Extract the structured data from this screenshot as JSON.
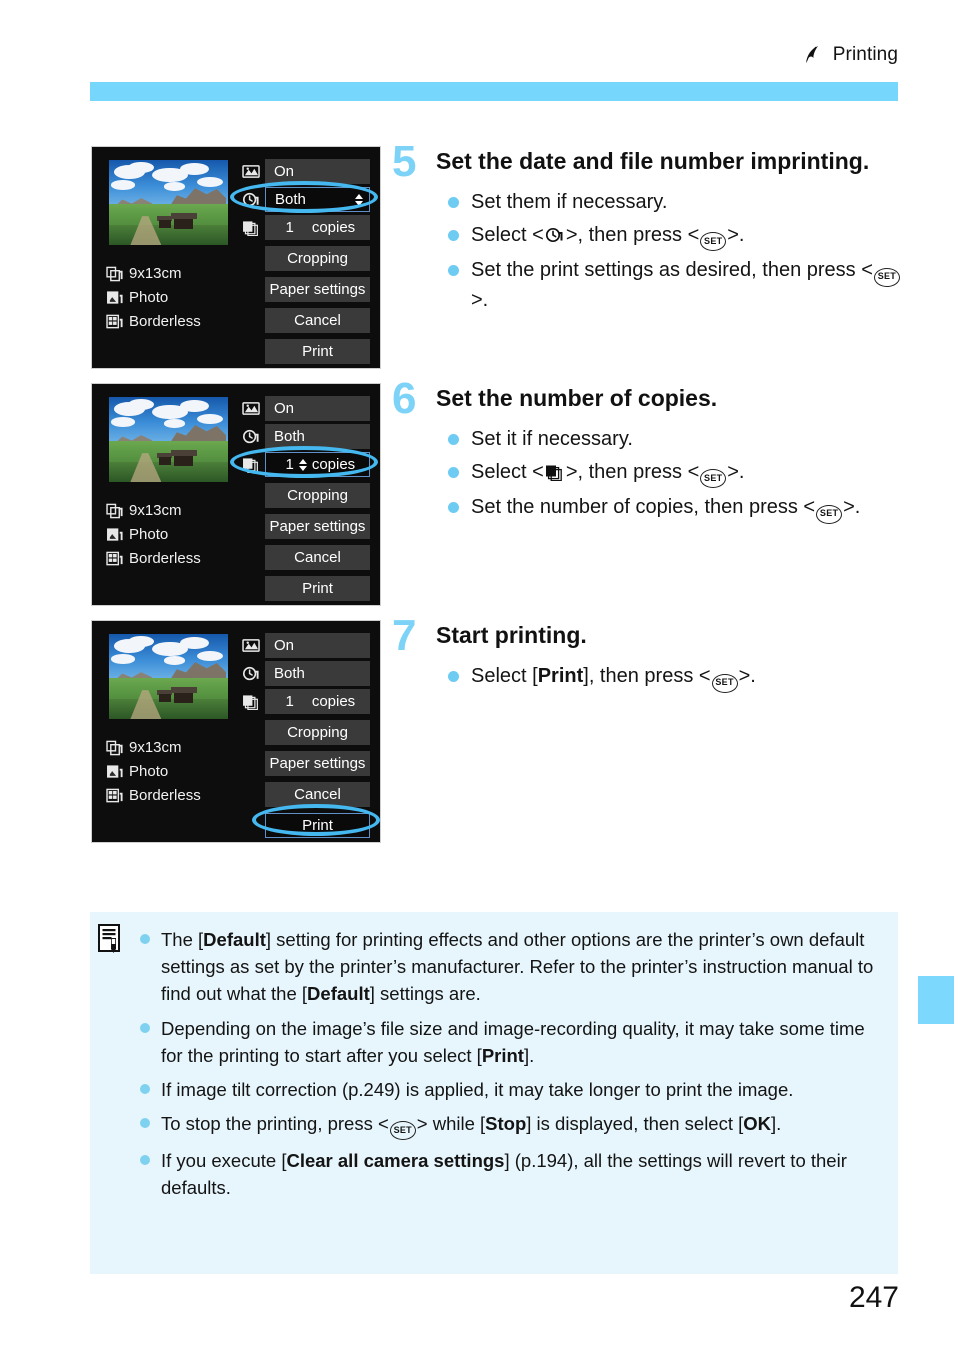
{
  "header": {
    "icon": "printing-chapter-icon",
    "title": "Printing"
  },
  "page_number": "247",
  "lcd_screens": [
    {
      "id": "screen-step5",
      "thumbnail_alt": "landscape-photo-thumbnail",
      "left_labels": [
        {
          "icon": "paper-size-icon",
          "label": "9x13cm"
        },
        {
          "icon": "paper-type-icon",
          "label": "Photo"
        },
        {
          "icon": "page-layout-icon",
          "label": "Borderless"
        }
      ],
      "options": [
        {
          "icon": "printing-effect-icon",
          "label": "On",
          "selected": false,
          "spinner": false
        },
        {
          "icon": "date-imprint-icon",
          "label": "Both",
          "selected": true,
          "spinner": true
        },
        {
          "icon": "copies-icon",
          "value": "1",
          "label": "copies",
          "selected": false,
          "spinner": false
        }
      ],
      "buttons": [
        {
          "label": "Cropping",
          "selected": false
        },
        {
          "label": "Paper settings",
          "selected": false
        },
        {
          "label": "Cancel",
          "selected": false
        },
        {
          "label": "Print",
          "selected": false
        }
      ],
      "highlight": "date-imprint-row"
    },
    {
      "id": "screen-step6",
      "thumbnail_alt": "landscape-photo-thumbnail",
      "left_labels": [
        {
          "icon": "paper-size-icon",
          "label": "9x13cm"
        },
        {
          "icon": "paper-type-icon",
          "label": "Photo"
        },
        {
          "icon": "page-layout-icon",
          "label": "Borderless"
        }
      ],
      "options": [
        {
          "icon": "printing-effect-icon",
          "label": "On",
          "selected": false,
          "spinner": false
        },
        {
          "icon": "date-imprint-icon",
          "label": "Both",
          "selected": false,
          "spinner": false
        },
        {
          "icon": "copies-icon",
          "value": "1",
          "label": "copies",
          "selected": true,
          "spinner": true
        }
      ],
      "buttons": [
        {
          "label": "Cropping",
          "selected": false
        },
        {
          "label": "Paper settings",
          "selected": false
        },
        {
          "label": "Cancel",
          "selected": false
        },
        {
          "label": "Print",
          "selected": false
        }
      ],
      "highlight": "copies-row"
    },
    {
      "id": "screen-step7",
      "thumbnail_alt": "landscape-photo-thumbnail",
      "left_labels": [
        {
          "icon": "paper-size-icon",
          "label": "9x13cm"
        },
        {
          "icon": "paper-type-icon",
          "label": "Photo"
        },
        {
          "icon": "page-layout-icon",
          "label": "Borderless"
        }
      ],
      "options": [
        {
          "icon": "printing-effect-icon",
          "label": "On",
          "selected": false,
          "spinner": false
        },
        {
          "icon": "date-imprint-icon",
          "label": "Both",
          "selected": false,
          "spinner": false
        },
        {
          "icon": "copies-icon",
          "value": "1",
          "label": "copies",
          "selected": false,
          "spinner": false
        }
      ],
      "buttons": [
        {
          "label": "Cropping",
          "selected": false
        },
        {
          "label": "Paper settings",
          "selected": false
        },
        {
          "label": "Cancel",
          "selected": false
        },
        {
          "label": "Print",
          "selected": true
        }
      ],
      "highlight": "print-button"
    }
  ],
  "steps": [
    {
      "number": "5",
      "title": "Set the date and file number imprinting.",
      "bullets": [
        {
          "parts": [
            {
              "t": "text",
              "v": "Set them if necessary."
            }
          ]
        },
        {
          "parts": [
            {
              "t": "text",
              "v": "Select <"
            },
            {
              "t": "icon",
              "v": "date-imprint-icon"
            },
            {
              "t": "text",
              "v": ">, then press <"
            },
            {
              "t": "set",
              "v": "SET"
            },
            {
              "t": "text",
              "v": ">."
            }
          ]
        },
        {
          "parts": [
            {
              "t": "text",
              "v": "Set the print settings as desired, then press <"
            },
            {
              "t": "set",
              "v": "SET"
            },
            {
              "t": "text",
              "v": ">."
            }
          ]
        }
      ]
    },
    {
      "number": "6",
      "title": "Set the number of copies.",
      "bullets": [
        {
          "parts": [
            {
              "t": "text",
              "v": "Set it if necessary."
            }
          ]
        },
        {
          "parts": [
            {
              "t": "text",
              "v": "Select <"
            },
            {
              "t": "icon",
              "v": "copies-icon"
            },
            {
              "t": "text",
              "v": ">, then press <"
            },
            {
              "t": "set",
              "v": "SET"
            },
            {
              "t": "text",
              "v": ">."
            }
          ]
        },
        {
          "parts": [
            {
              "t": "text",
              "v": "Set the number of copies, then press <"
            },
            {
              "t": "set",
              "v": "SET"
            },
            {
              "t": "text",
              "v": ">."
            }
          ]
        }
      ]
    },
    {
      "number": "7",
      "title": "Start printing.",
      "bullets": [
        {
          "parts": [
            {
              "t": "text",
              "v": "Select ["
            },
            {
              "t": "bold",
              "v": "Print"
            },
            {
              "t": "text",
              "v": "], then press <"
            },
            {
              "t": "set",
              "v": "SET"
            },
            {
              "t": "text",
              "v": ">."
            }
          ]
        }
      ]
    }
  ],
  "note_box": {
    "icon": "note-memo-icon",
    "items": [
      {
        "parts": [
          {
            "t": "text",
            "v": "The ["
          },
          {
            "t": "bold",
            "v": "Default"
          },
          {
            "t": "text",
            "v": "] setting for printing effects and other options are the printer’s own default settings as set by the printer’s manufacturer. Refer to the printer’s instruction manual to find out what the ["
          },
          {
            "t": "bold",
            "v": "Default"
          },
          {
            "t": "text",
            "v": "] settings are."
          }
        ]
      },
      {
        "parts": [
          {
            "t": "text",
            "v": "Depending on the image’s file size and image-recording quality, it may take some time for the printing to start after you select ["
          },
          {
            "t": "bold",
            "v": "Print"
          },
          {
            "t": "text",
            "v": "]."
          }
        ]
      },
      {
        "parts": [
          {
            "t": "text",
            "v": "If image tilt correction (p.249) is applied, it may take longer to print the image."
          }
        ]
      },
      {
        "parts": [
          {
            "t": "text",
            "v": "To stop the printing, press <"
          },
          {
            "t": "set",
            "v": "SET"
          },
          {
            "t": "text",
            "v": "> while ["
          },
          {
            "t": "bold",
            "v": "Stop"
          },
          {
            "t": "text",
            "v": "] is displayed, then select ["
          },
          {
            "t": "bold",
            "v": "OK"
          },
          {
            "t": "text",
            "v": "]."
          }
        ]
      },
      {
        "parts": [
          {
            "t": "text",
            "v": "If you execute ["
          },
          {
            "t": "bold",
            "v": "Clear all camera settings"
          },
          {
            "t": "text",
            "v": "] (p.194), all the settings will revert to their defaults."
          }
        ]
      }
    ]
  },
  "colors": {
    "accent_blue": "#76d6fb",
    "step_number_blue": "#7dd3f7",
    "note_bg": "#e7f6fd",
    "highlight_ring": "#45b8f0",
    "lcd_bg": "#0d0d0d"
  }
}
